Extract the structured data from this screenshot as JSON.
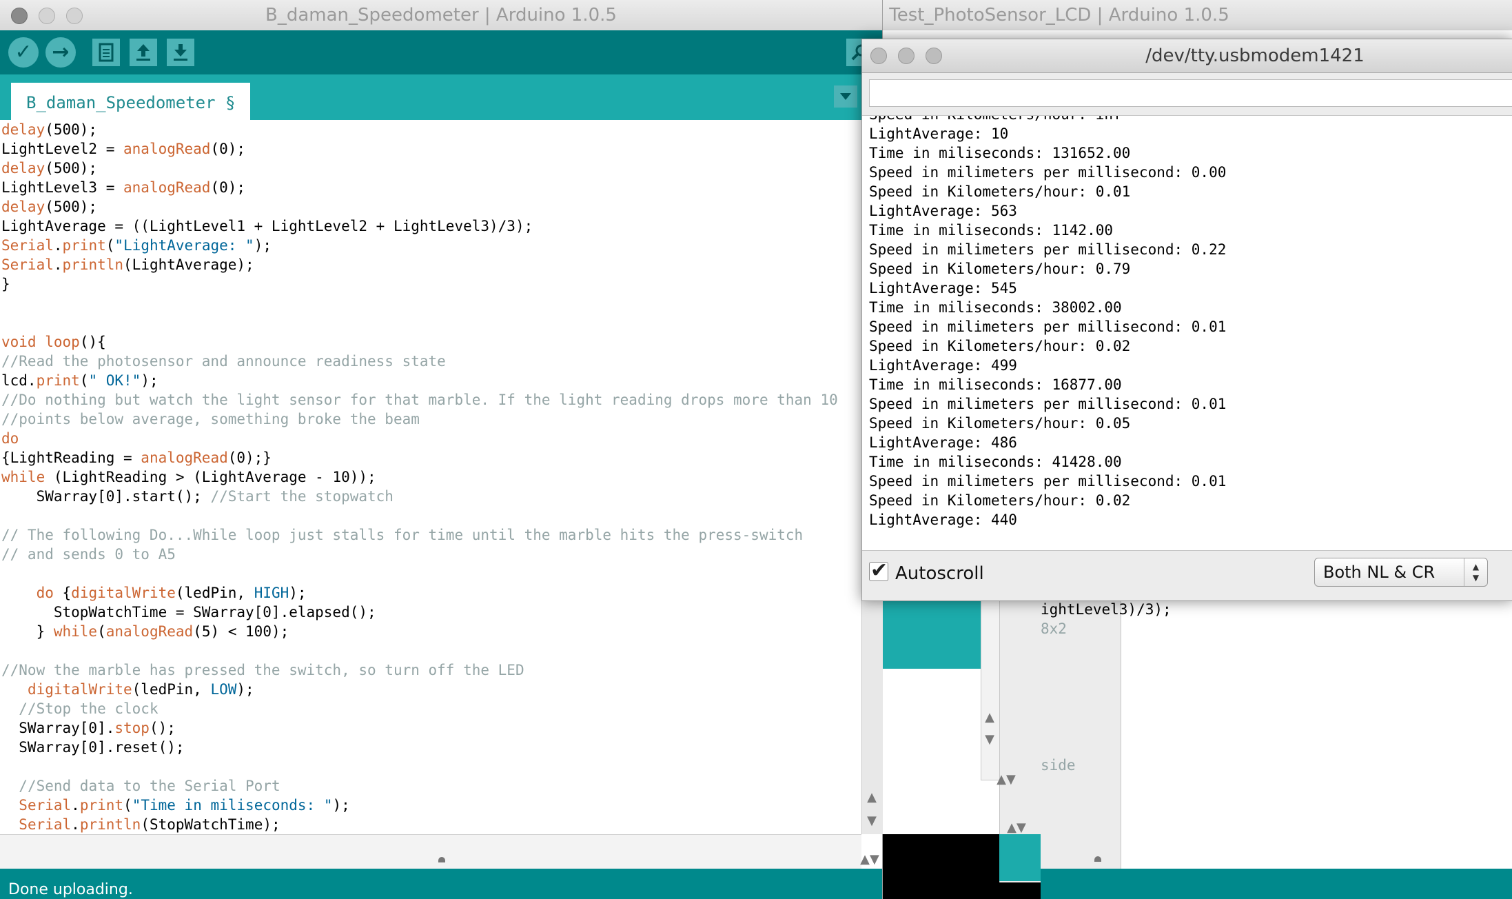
{
  "main_window": {
    "title": "B_daman_Speedometer | Arduino 1.0.5",
    "tab_label": "B_daman_Speedometer §",
    "status_text": "Done uploading.",
    "code_lines": [
      [
        [
          "fn",
          "delay"
        ],
        [
          "t",
          "(500);"
        ]
      ],
      [
        [
          "t",
          "LightLevel2 = "
        ],
        [
          "fn",
          "analogRead"
        ],
        [
          "t",
          "(0);"
        ]
      ],
      [
        [
          "fn",
          "delay"
        ],
        [
          "t",
          "(500);"
        ]
      ],
      [
        [
          "t",
          "LightLevel3 = "
        ],
        [
          "fn",
          "analogRead"
        ],
        [
          "t",
          "(0);"
        ]
      ],
      [
        [
          "fn",
          "delay"
        ],
        [
          "t",
          "(500);"
        ]
      ],
      [
        [
          "t",
          "LightAverage = ((LightLevel1 + LightLevel2 + LightLevel3)/3);"
        ]
      ],
      [
        [
          "kw",
          "Serial"
        ],
        [
          "t",
          "."
        ],
        [
          "fn",
          "print"
        ],
        [
          "t",
          "("
        ],
        [
          "str",
          "\"LightAverage: \""
        ],
        [
          "t",
          ");"
        ]
      ],
      [
        [
          "kw",
          "Serial"
        ],
        [
          "t",
          "."
        ],
        [
          "fn",
          "println"
        ],
        [
          "t",
          "(LightAverage);"
        ]
      ],
      [
        [
          "t",
          "}"
        ]
      ],
      [
        [
          "t",
          ""
        ]
      ],
      [
        [
          "t",
          ""
        ]
      ],
      [
        [
          "kw",
          "void"
        ],
        [
          "t",
          " "
        ],
        [
          "fn",
          "loop"
        ],
        [
          "t",
          "(){"
        ]
      ],
      [
        [
          "cm",
          "//Read the photosensor and announce readiness state"
        ]
      ],
      [
        [
          "t",
          "lcd."
        ],
        [
          "fn",
          "print"
        ],
        [
          "t",
          "("
        ],
        [
          "str",
          "\" OK!\""
        ],
        [
          "t",
          ");"
        ]
      ],
      [
        [
          "cm",
          "//Do nothing but watch the light sensor for that marble. If the light reading drops more than 10"
        ]
      ],
      [
        [
          "cm",
          "//points below average, something broke the beam"
        ]
      ],
      [
        [
          "kw",
          "do"
        ]
      ],
      [
        [
          "t",
          "{LightReading = "
        ],
        [
          "fn",
          "analogRead"
        ],
        [
          "t",
          "(0);}"
        ]
      ],
      [
        [
          "kw",
          "while"
        ],
        [
          "t",
          " (LightReading > (LightAverage - 10));"
        ]
      ],
      [
        [
          "t",
          "    SWarray[0].start(); "
        ],
        [
          "cm",
          "//Start the stopwatch"
        ]
      ],
      [
        [
          "t",
          ""
        ]
      ],
      [
        [
          "cm",
          "// The following Do...While loop just stalls for time until the marble hits the press-switch"
        ]
      ],
      [
        [
          "cm",
          "// and sends 0 to A5"
        ]
      ],
      [
        [
          "t",
          ""
        ]
      ],
      [
        [
          "t",
          "    "
        ],
        [
          "kw",
          "do"
        ],
        [
          "t",
          " {"
        ],
        [
          "fn",
          "digitalWrite"
        ],
        [
          "t",
          "(ledPin, "
        ],
        [
          "cst",
          "HIGH"
        ],
        [
          "t",
          ");"
        ]
      ],
      [
        [
          "t",
          "      StopWatchTime = SWarray[0].elapsed();"
        ]
      ],
      [
        [
          "t",
          "    } "
        ],
        [
          "kw",
          "while"
        ],
        [
          "t",
          "("
        ],
        [
          "fn",
          "analogRead"
        ],
        [
          "t",
          "(5) < 100);"
        ]
      ],
      [
        [
          "t",
          ""
        ]
      ],
      [
        [
          "cm",
          "//Now the marble has pressed the switch, so turn off the LED"
        ]
      ],
      [
        [
          "t",
          "   "
        ],
        [
          "fn",
          "digitalWrite"
        ],
        [
          "t",
          "(ledPin, "
        ],
        [
          "cst",
          "LOW"
        ],
        [
          "t",
          ");"
        ]
      ],
      [
        [
          "t",
          "  "
        ],
        [
          "cm",
          "//Stop the clock"
        ]
      ],
      [
        [
          "t",
          "  SWarray[0]."
        ],
        [
          "fn",
          "stop"
        ],
        [
          "t",
          "();"
        ]
      ],
      [
        [
          "t",
          "  SWarray[0].reset();"
        ]
      ],
      [
        [
          "t",
          ""
        ]
      ],
      [
        [
          "t",
          "  "
        ],
        [
          "cm",
          "//Send data to the Serial Port"
        ]
      ],
      [
        [
          "t",
          "  "
        ],
        [
          "kw",
          "Serial"
        ],
        [
          "t",
          "."
        ],
        [
          "fn",
          "print"
        ],
        [
          "t",
          "("
        ],
        [
          "str",
          "\"Time in miliseconds: \""
        ],
        [
          "t",
          ");"
        ]
      ],
      [
        [
          "t",
          "  "
        ],
        [
          "kw",
          "Serial"
        ],
        [
          "t",
          "."
        ],
        [
          "fn",
          "println"
        ],
        [
          "t",
          "(StopWatchTime);"
        ]
      ]
    ]
  },
  "back_window": {
    "title": "Test_PhotoSensor_LCD | Arduino 1.0.5",
    "code_fragments": [
      "ightLevel3)/3);",
      "8x2",
      "side"
    ]
  },
  "serial_monitor": {
    "title": "/dev/tty.usbmodem1421",
    "input_value": "",
    "partial_top_line": "Speed in Kilometers/hour: inf",
    "output_lines": [
      "LightAverage: 10",
      "Time in miliseconds: 131652.00",
      "Speed in milimeters per millisecond: 0.00",
      "Speed in Kilometers/hour: 0.01",
      "LightAverage: 563",
      "Time in miliseconds: 1142.00",
      "Speed in milimeters per millisecond: 0.22",
      "Speed in Kilometers/hour: 0.79",
      "LightAverage: 545",
      "Time in miliseconds: 38002.00",
      "Speed in milimeters per millisecond: 0.01",
      "Speed in Kilometers/hour: 0.02",
      "LightAverage: 499",
      "Time in miliseconds: 16877.00",
      "Speed in milimeters per millisecond: 0.01",
      "Speed in Kilometers/hour: 0.05",
      "LightAverage: 486",
      "Time in miliseconds: 41428.00",
      "Speed in milimeters per millisecond: 0.01",
      "Speed in Kilometers/hour: 0.02",
      "LightAverage: 440"
    ],
    "autoscroll_label": "Autoscroll",
    "autoscroll_checked": true,
    "line_ending_selected": "Both NL & CR"
  },
  "icons": {
    "verify": "✓",
    "upload": "→",
    "new": "new-file-icon",
    "open": "open-icon",
    "save": "save-icon",
    "serial_monitor": "magnifier-icon",
    "tab_menu": "triangle-down-icon",
    "checkmark": "✔"
  },
  "colors": {
    "toolbar": "#00797c",
    "tabbar": "#1cabab",
    "status": "#00898c",
    "keyword": "#cc6633",
    "string": "#006699",
    "comment": "#95a5a6"
  }
}
